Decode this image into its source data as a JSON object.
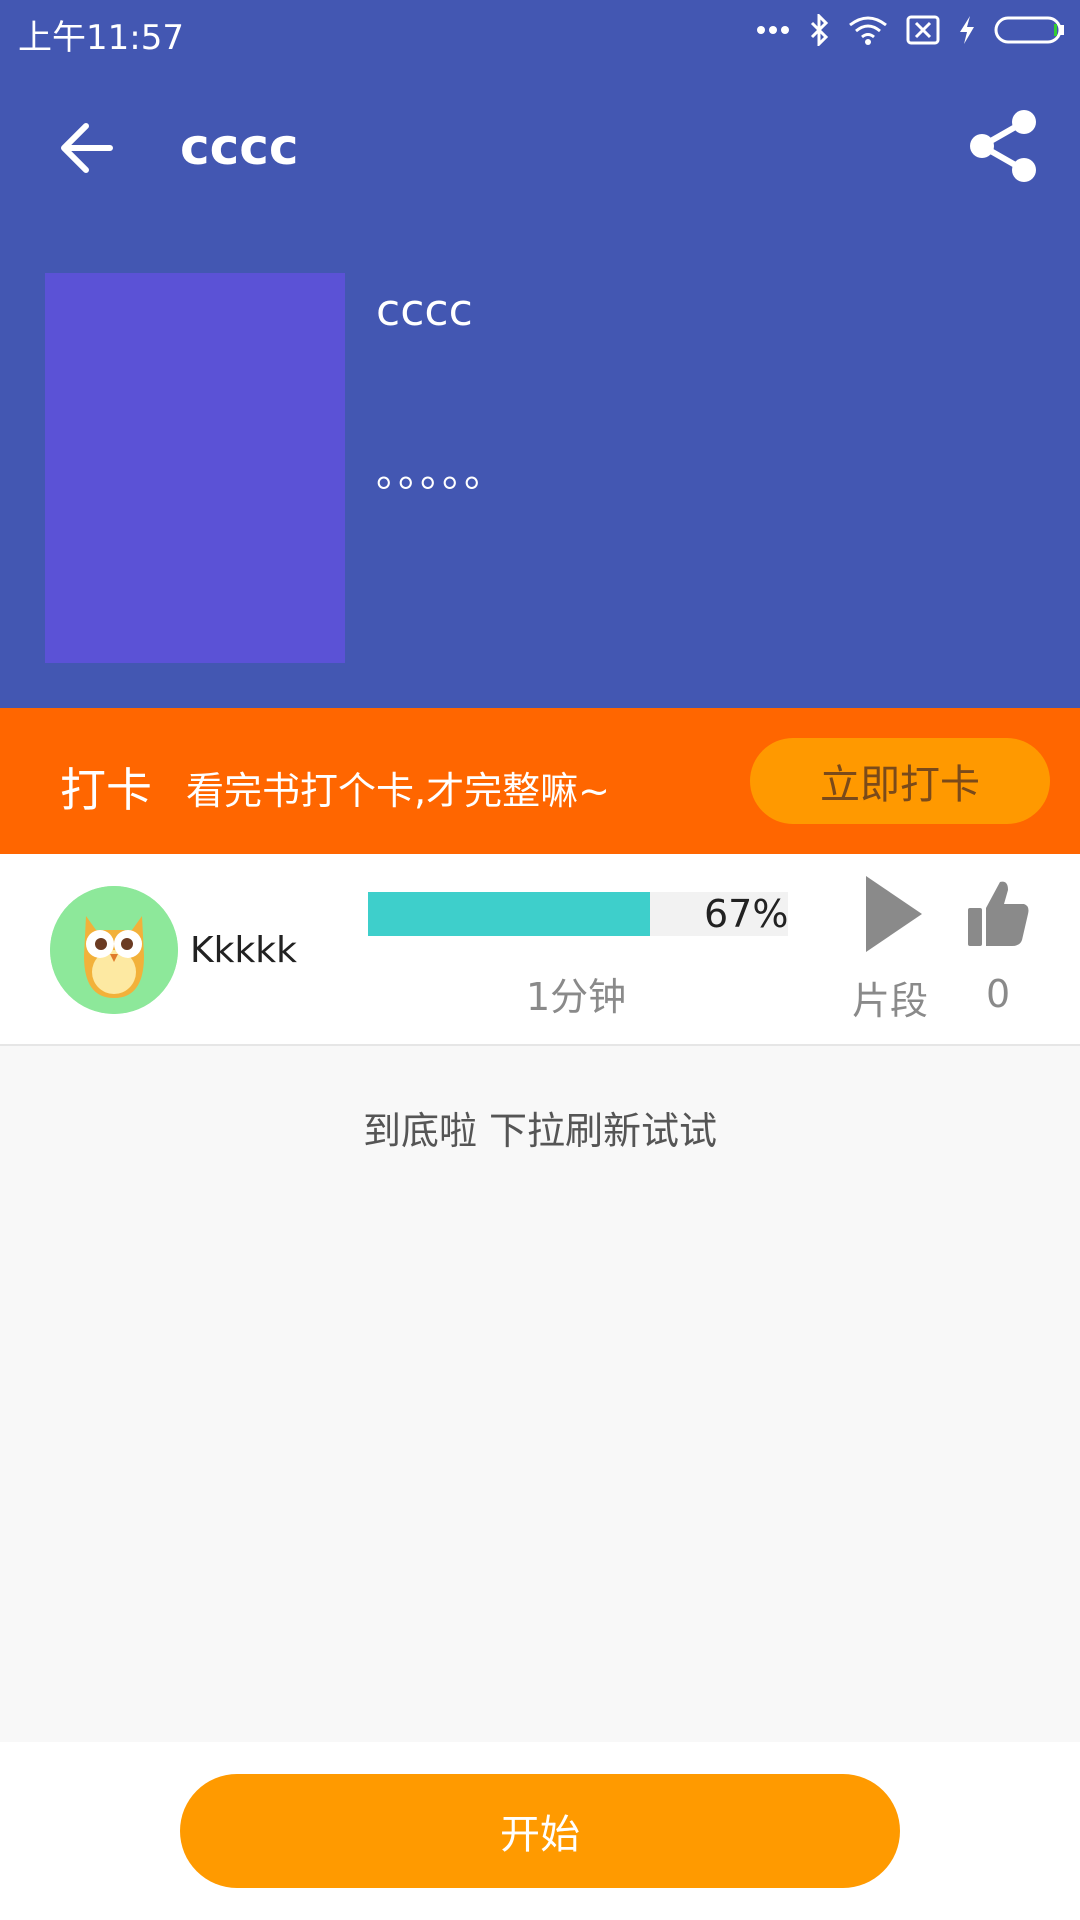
{
  "status_bar": {
    "time": "上午11:57",
    "icons": [
      "more-dots-icon",
      "bluetooth-icon",
      "wifi-icon",
      "sim-x-icon",
      "charging-icon",
      "battery-icon"
    ]
  },
  "app_bar": {
    "title": "cccc",
    "back_icon": "arrow-left-icon",
    "share_icon": "share-icon"
  },
  "book": {
    "title": "cccc",
    "description": "。。。。。",
    "cover_color": "#5b52d6"
  },
  "checkin": {
    "label": "打卡",
    "message": "看完书打个卡,才完整嘛~",
    "button": "立即打卡"
  },
  "record": {
    "username": "Kkkkk",
    "progress_percent": 67,
    "progress_text": "67%",
    "duration": "1分钟",
    "play_label": "片段",
    "like_count": "0"
  },
  "list_end_text": "到底啦 下拉刷新试试",
  "bottom": {
    "start_button": "开始"
  },
  "colors": {
    "header_bg": "#4357b2",
    "checkin_bg": "#ff6600",
    "accent_orange": "#ff9900",
    "progress_fill": "#3ecfcb"
  }
}
